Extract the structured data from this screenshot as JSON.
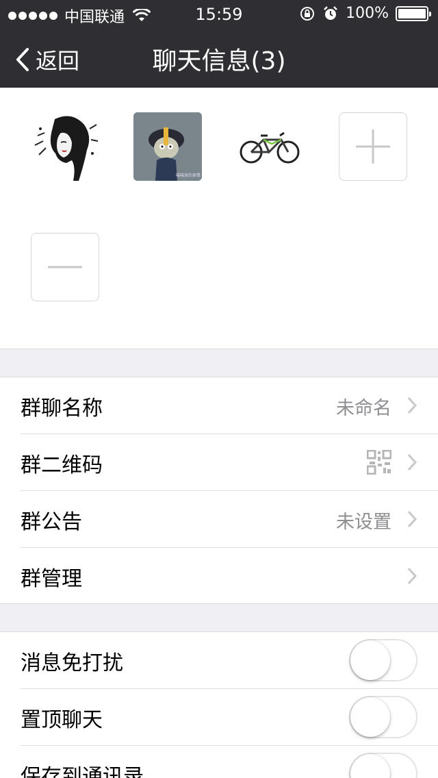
{
  "status_bar": {
    "carrier": "中国联通",
    "time": "15:59",
    "battery": "100%",
    "battery_level": 1.0
  },
  "nav": {
    "back_label": "返回",
    "title": "聊天信息(3)"
  },
  "members": [
    {
      "name": "member-avatar-1",
      "icon": "girl-sketch-avatar"
    },
    {
      "name": "member-avatar-2",
      "icon": "cartoon-zombie-avatar",
      "caption": "喵喵发的表情"
    },
    {
      "name": "member-avatar-3",
      "icon": "bicycle-avatar"
    }
  ],
  "group_settings": [
    {
      "label": "群聊名称",
      "value": "未命名"
    },
    {
      "label": "群二维码",
      "icon": "qr-code-icon"
    },
    {
      "label": "群公告",
      "value": "未设置"
    },
    {
      "label": "群管理"
    }
  ],
  "toggles": [
    {
      "label": "消息免打扰",
      "on": false
    },
    {
      "label": "置顶聊天",
      "on": false
    },
    {
      "label": "保存到通讯录",
      "on": false
    }
  ],
  "colors": {
    "header_bg": "#2f2f33",
    "page_bg": "#efeff4",
    "secondary_text": "#8e8e93"
  }
}
